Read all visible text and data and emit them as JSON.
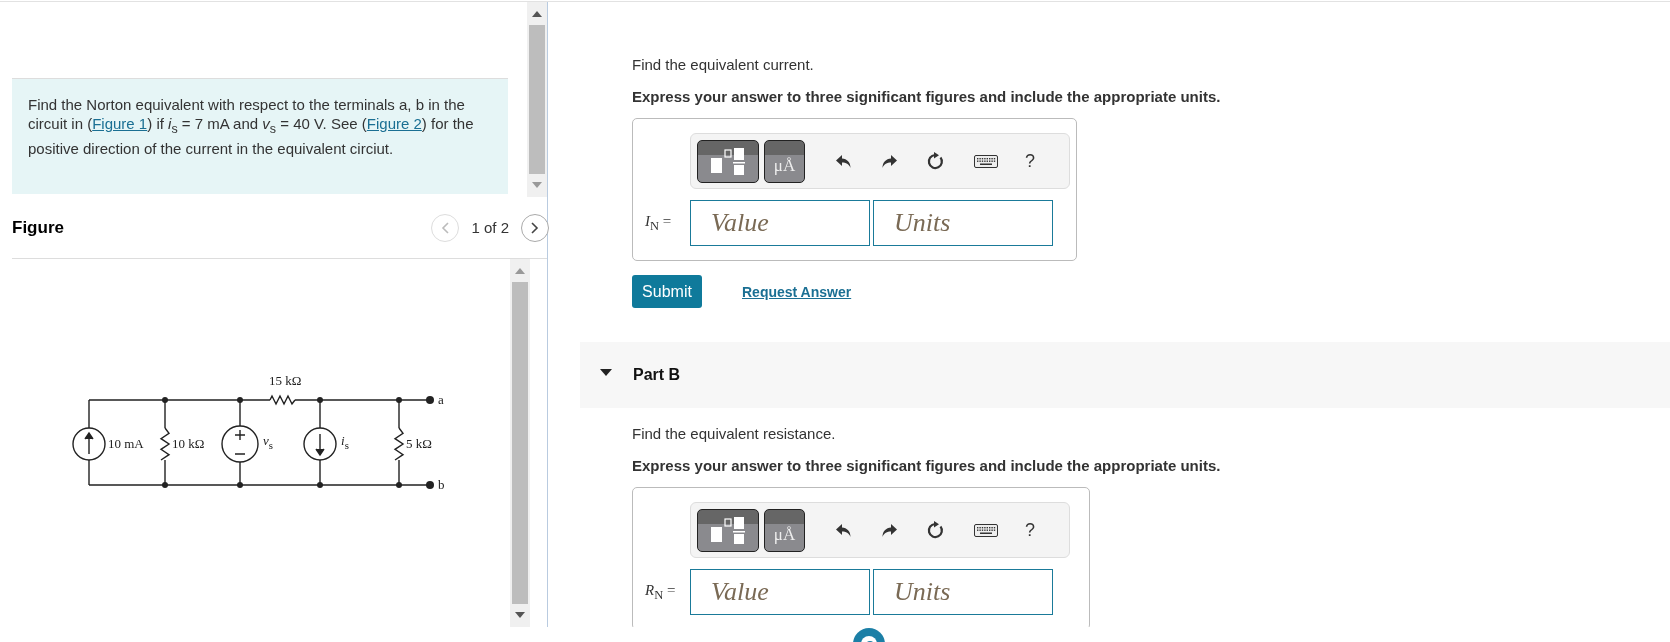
{
  "problem": {
    "parts": [
      {
        "kind": "text",
        "text": "Find the Norton equivalent with respect to the terminals a, b in the circuit in ("
      },
      {
        "kind": "link",
        "text": "Figure 1"
      },
      {
        "kind": "text",
        "text": ") if *i*$_{s}$ = 7 mA and *v*$_{s}$ = 40 V. See ("
      },
      {
        "kind": "link",
        "text": "Figure 2"
      },
      {
        "kind": "text",
        "text": ") for the positive direction of the current in the equivalent circiut."
      }
    ]
  },
  "figure": {
    "title": "Figure",
    "pager": {
      "prev_disabled": true,
      "label": "1 of 2",
      "next_disabled": false
    }
  },
  "circuit": {
    "labels": [
      {
        "kind": "series_resistor",
        "text": "15 kΩ"
      },
      {
        "kind": "source_current",
        "text": "10 mA"
      },
      {
        "kind": "shunt_resistor",
        "text": "10 kΩ"
      },
      {
        "kind": "voltage_source",
        "text": "*v*$_{s}$"
      },
      {
        "kind": "dependent_current",
        "text": "*i*$_{s}$"
      },
      {
        "kind": "load_resistor",
        "text": "5 kΩ"
      },
      {
        "kind": "terminal_a",
        "text": "a"
      },
      {
        "kind": "terminal_b",
        "text": "b"
      }
    ]
  },
  "parts": [
    {
      "prompt": "Find the equivalent current.",
      "instruction": "Express your answer to three significant figures and include the appropriate units.",
      "toolbar": {
        "unit_button": "μÅ",
        "help": "?"
      },
      "answer": {
        "label": "*I*$_{N}$ =",
        "value_placeholder": "Value",
        "units_placeholder": "Units"
      },
      "actions": {
        "submit": "Submit",
        "request": "Request Answer"
      }
    },
    {
      "header": {
        "title": "Part B",
        "expanded": true
      },
      "prompt": "Find the equivalent resistance.",
      "instruction": "Express your answer to three significant figures and include the appropriate units.",
      "toolbar": {
        "unit_button": "μÅ",
        "help": "?"
      },
      "answer": {
        "label": "*R*$_{N}$ =",
        "value_placeholder": "Value",
        "units_placeholder": "Units"
      }
    }
  ]
}
